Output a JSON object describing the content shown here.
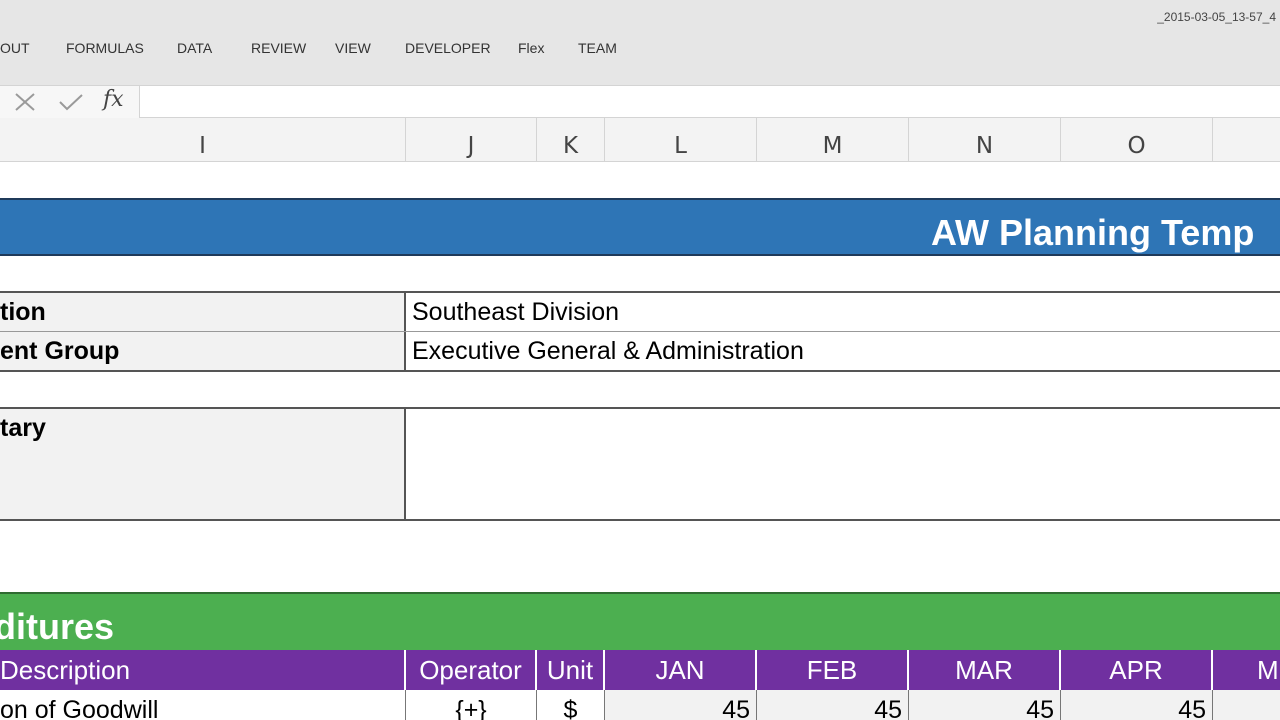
{
  "window": {
    "title_fragment": "_2015-03-05_13-57_4"
  },
  "ribbon": {
    "tabs": [
      "OUT",
      "FORMULAS",
      "DATA",
      "REVIEW",
      "VIEW",
      "DEVELOPER",
      "Flex",
      "TEAM"
    ]
  },
  "formula_bar": {
    "fx_label": "fx",
    "value": ""
  },
  "columns": [
    "I",
    "J",
    "K",
    "L",
    "M",
    "N",
    "O"
  ],
  "sheet": {
    "title": "AW Planning Temp",
    "fields": [
      {
        "label": "tion",
        "value": "Southeast Division"
      },
      {
        "label": "ent Group",
        "value": "Executive General & Administration"
      },
      {
        "label": "tary",
        "value": ""
      }
    ],
    "section_title": "ditures",
    "table": {
      "headers": [
        "Description",
        "Operator",
        "Unit",
        "JAN",
        "FEB",
        "MAR",
        "APR",
        "M"
      ],
      "rows": [
        {
          "description": "on of Goodwill",
          "operator": "{+}",
          "unit": "$",
          "values": [
            "45",
            "45",
            "45",
            "45"
          ]
        }
      ]
    }
  }
}
